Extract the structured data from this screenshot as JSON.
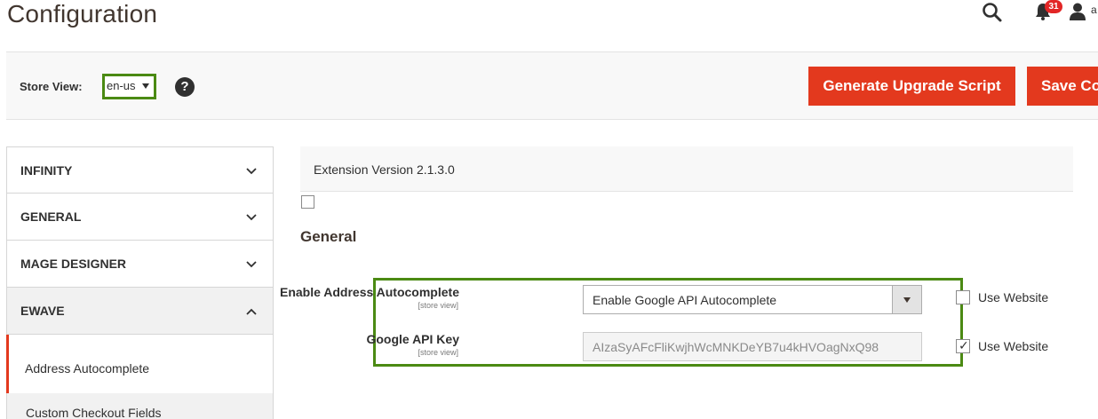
{
  "header": {
    "title": "Configuration",
    "notifications_count": "31",
    "user_initial": "a"
  },
  "toolbar": {
    "store_view_label": "Store View:",
    "store_view_value": "en-us",
    "help_glyph": "?",
    "generate_upgrade_label": "Generate Upgrade Script",
    "save_label": "Save Co"
  },
  "sidebar": {
    "sections": [
      {
        "label": "INFINITY",
        "state": "collapsed"
      },
      {
        "label": "GENERAL",
        "state": "collapsed"
      },
      {
        "label": "MAGE DESIGNER",
        "state": "collapsed"
      },
      {
        "label": "EWAVE",
        "state": "expanded"
      }
    ],
    "ewave_items": [
      {
        "label": "Address Autocomplete",
        "active": true
      },
      {
        "label": "Custom Checkout Fields",
        "active": false
      }
    ]
  },
  "main": {
    "extension_version": "Extension Version 2.1.3.0",
    "section_title": "General",
    "fields": [
      {
        "label": "Enable Address Autocomplete",
        "scope": "[store view]",
        "type": "select",
        "value": "Enable Google API Autocomplete",
        "use_website_label": "Use Website",
        "use_website_checked": false
      },
      {
        "label": "Google API Key",
        "scope": "[store view]",
        "type": "text",
        "value": "AIzaSyAFcFliKwjhWcMNKDeYB7u4kHVOagNxQ98",
        "use_website_label": "Use Website",
        "use_website_checked": true
      }
    ]
  },
  "colors": {
    "accent_button": "#e3391e",
    "highlight_border": "#4b8a13",
    "badge": "#e22626"
  }
}
